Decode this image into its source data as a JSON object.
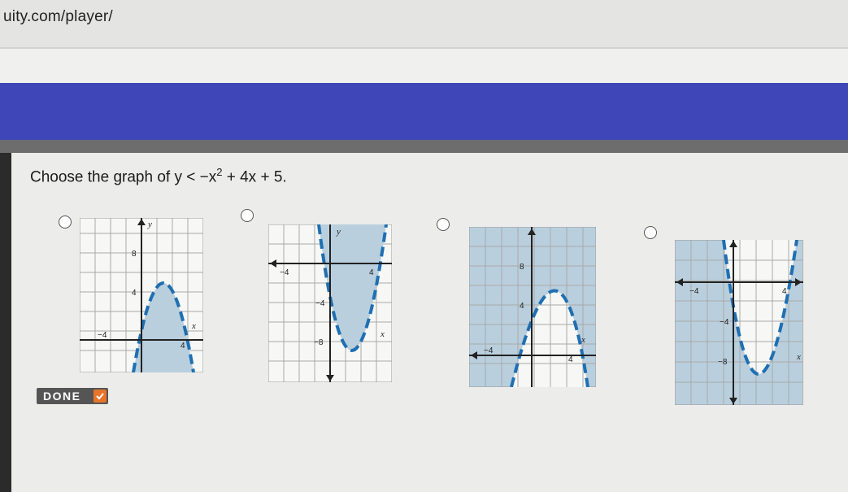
{
  "browser": {
    "url": "uity.com/player/"
  },
  "question": {
    "prefix": "Choose the graph of ",
    "lhs": "y < −x",
    "exp": "2",
    "rhs": " + 4x + 5."
  },
  "options": [
    {
      "id": "A",
      "labels": {
        "y": "y",
        "x": "x",
        "ytick_pos": "8",
        "ytick_pos2": "4",
        "xtick_neg": "−4",
        "xtick_pos": "4"
      },
      "shaded": "inside-curve",
      "parabola_opens": "down"
    },
    {
      "id": "B",
      "labels": {
        "y": "y",
        "x": "x",
        "xtick_neg": "−4",
        "xtick_pos": "4",
        "ytick_neg": "−4",
        "ytick_neg2": "−8"
      },
      "shaded": "inside-curve",
      "parabola_opens": "up"
    },
    {
      "id": "C",
      "labels": {
        "x": "x",
        "ytick_pos": "8",
        "ytick_pos2": "4",
        "xtick_neg": "−4",
        "xtick_pos": "4"
      },
      "shaded": "outside-curve",
      "parabola_opens": "down"
    },
    {
      "id": "D",
      "labels": {
        "x": "x",
        "xtick_neg": "−4",
        "xtick_pos": "4",
        "ytick_neg": "−4",
        "ytick_neg2": "−8"
      },
      "shaded": "outside-curve",
      "parabola_opens": "up"
    }
  ],
  "done": {
    "label": "DONE"
  },
  "colors": {
    "banner": "#3f46b8",
    "shade": "#b9cfdd",
    "curve": "#1f6fb2",
    "done_bg": "#555555",
    "check": "#e8742b"
  }
}
